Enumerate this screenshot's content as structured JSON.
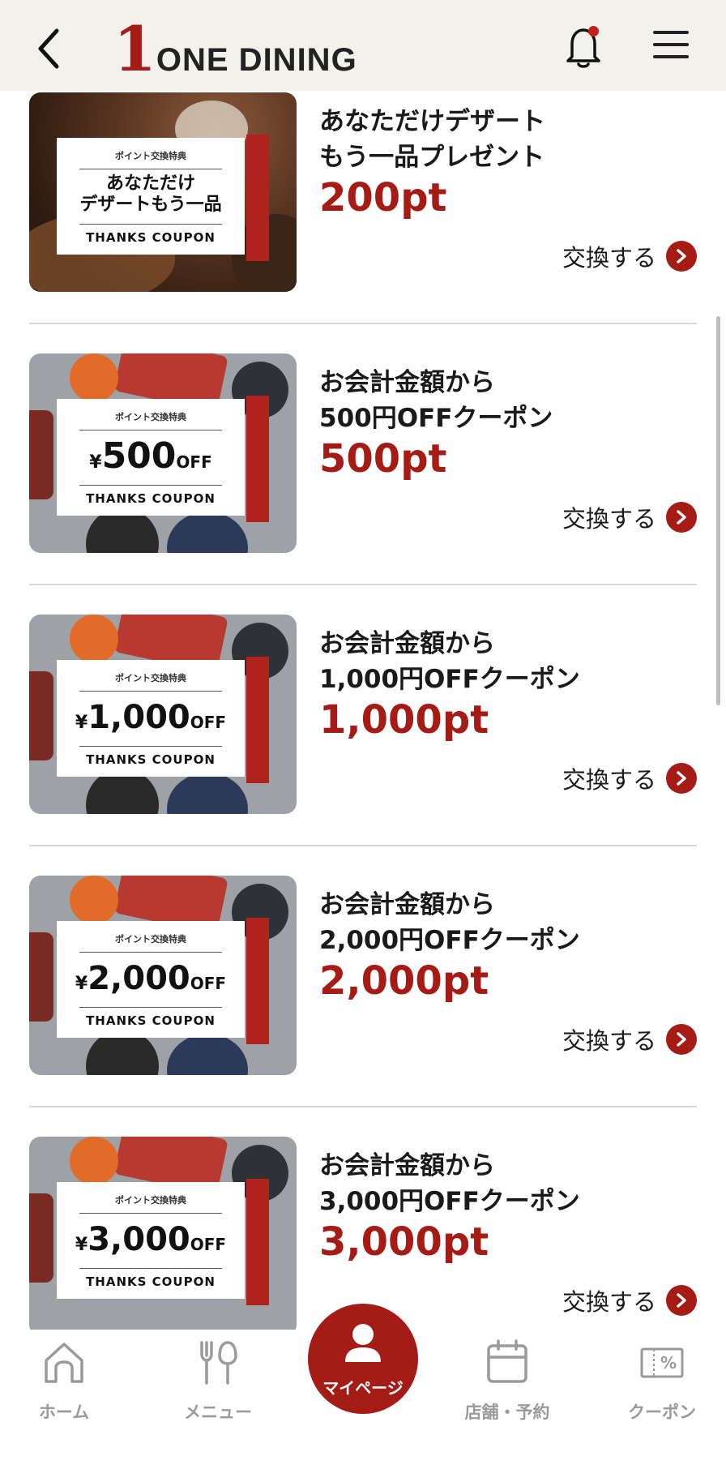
{
  "header": {
    "logo_number": "1",
    "logo_text": "ONE DINING"
  },
  "rewards": [
    {
      "title": "あなただけデザート\nもう一品プレゼント",
      "points": "200pt",
      "action": "交換する",
      "card": {
        "top": "ポイント交換特典",
        "main_line1": "あなただけ",
        "main_line2": "デザートもう一品",
        "bottom": "THANKS COUPON"
      }
    },
    {
      "title": "お会計金額から\n500円OFFクーポン",
      "points": "500pt",
      "action": "交換する",
      "card": {
        "top": "ポイント交換特典",
        "yen": "¥",
        "amount": "500",
        "off": "OFF",
        "bottom": "THANKS COUPON"
      }
    },
    {
      "title": "お会計金額から\n1,000円OFFクーポン",
      "points": "1,000pt",
      "action": "交換する",
      "card": {
        "top": "ポイント交換特典",
        "yen": "¥",
        "amount": "1,000",
        "off": "OFF",
        "bottom": "THANKS COUPON"
      }
    },
    {
      "title": "お会計金額から\n2,000円OFFクーポン",
      "points": "2,000pt",
      "action": "交換する",
      "card": {
        "top": "ポイント交換特典",
        "yen": "¥",
        "amount": "2,000",
        "off": "OFF",
        "bottom": "THANKS COUPON"
      }
    },
    {
      "title": "お会計金額から\n3,000円OFFクーポン",
      "points": "3,000pt",
      "action": "交換する",
      "card": {
        "top": "ポイント交換特典",
        "yen": "¥",
        "amount": "3,000",
        "off": "OFF",
        "bottom": "THANKS COUPON"
      }
    }
  ],
  "bottom_nav": {
    "home": "ホーム",
    "menu": "メニュー",
    "mypage": "マイページ",
    "stores": "店舗・予約",
    "coupon": "クーポン"
  },
  "colors": {
    "accent": "#a51c17",
    "header_bg": "#f3f1ec",
    "nav_inactive": "#9a9a9a"
  },
  "icons": {
    "back": "back-chevron-icon",
    "bell": "bell-icon",
    "menu": "hamburger-menu-icon",
    "home": "home-icon",
    "menu_nav": "fork-spoon-icon",
    "mypage": "person-icon",
    "stores": "calendar-icon",
    "coupon": "coupon-percent-icon",
    "exchange": "chevron-right-circle-icon"
  }
}
